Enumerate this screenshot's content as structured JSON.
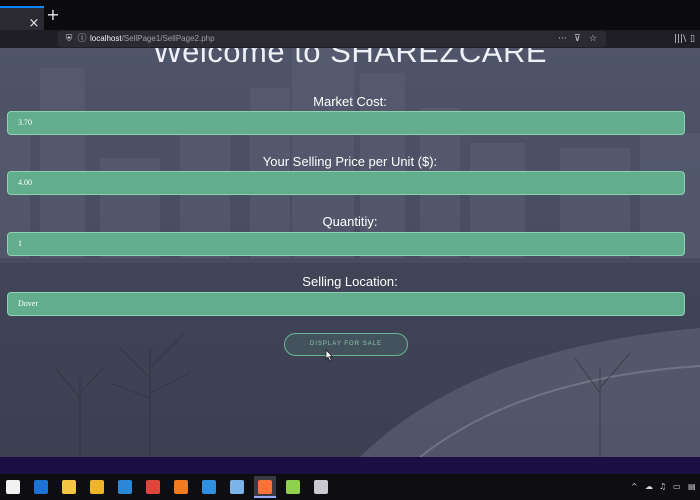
{
  "browser": {
    "tab_close_glyph": "×",
    "new_tab_glyph": "+",
    "url_host": "localhost",
    "url_path": "/SellPage1/SellPage2.php",
    "menu_dots": "···",
    "library_glyph": "|||\\",
    "sidebar_glyph": "▯"
  },
  "page": {
    "title": "Welcome to SHAREZCARE",
    "fields": [
      {
        "label": "Market Cost:",
        "value": "3.70"
      },
      {
        "label": "Your Selling Price per Unit ($):",
        "value": "4.00"
      },
      {
        "label": "Quantitiy:",
        "value": "1"
      },
      {
        "label": "Selling Location:",
        "value": "Dover"
      }
    ],
    "button_label": "DISPLAY FOR SALE"
  },
  "taskbar": {
    "items": [
      {
        "icon": "store-icon",
        "color": "#f2f2f2"
      },
      {
        "icon": "calendar-app-icon",
        "color": "#1e73d8"
      },
      {
        "icon": "sticky-notes-icon",
        "color": "#f5c542"
      },
      {
        "icon": "file-explorer-icon",
        "color": "#f0b429"
      },
      {
        "icon": "mail-icon",
        "color": "#2b88d8"
      },
      {
        "icon": "chrome-icon",
        "color": "#e0443a"
      },
      {
        "icon": "xampp-icon",
        "color": "#f27a20"
      },
      {
        "icon": "vscode-icon",
        "color": "#2f8fe0"
      },
      {
        "icon": "notepad-icon",
        "color": "#7ab4e8"
      },
      {
        "icon": "firefox-icon",
        "color": "#ff7139"
      },
      {
        "icon": "git-icon",
        "color": "#8fd14f"
      },
      {
        "icon": "steam-icon",
        "color": "#c9c9cf"
      }
    ],
    "active_index": 9
  },
  "colors": {
    "input_bg": "#62ad8c",
    "input_border": "#8fd0b1",
    "button_border": "#65b596",
    "page_bg": "#4a4e62",
    "taskbar_accent": "#1b0e42"
  }
}
